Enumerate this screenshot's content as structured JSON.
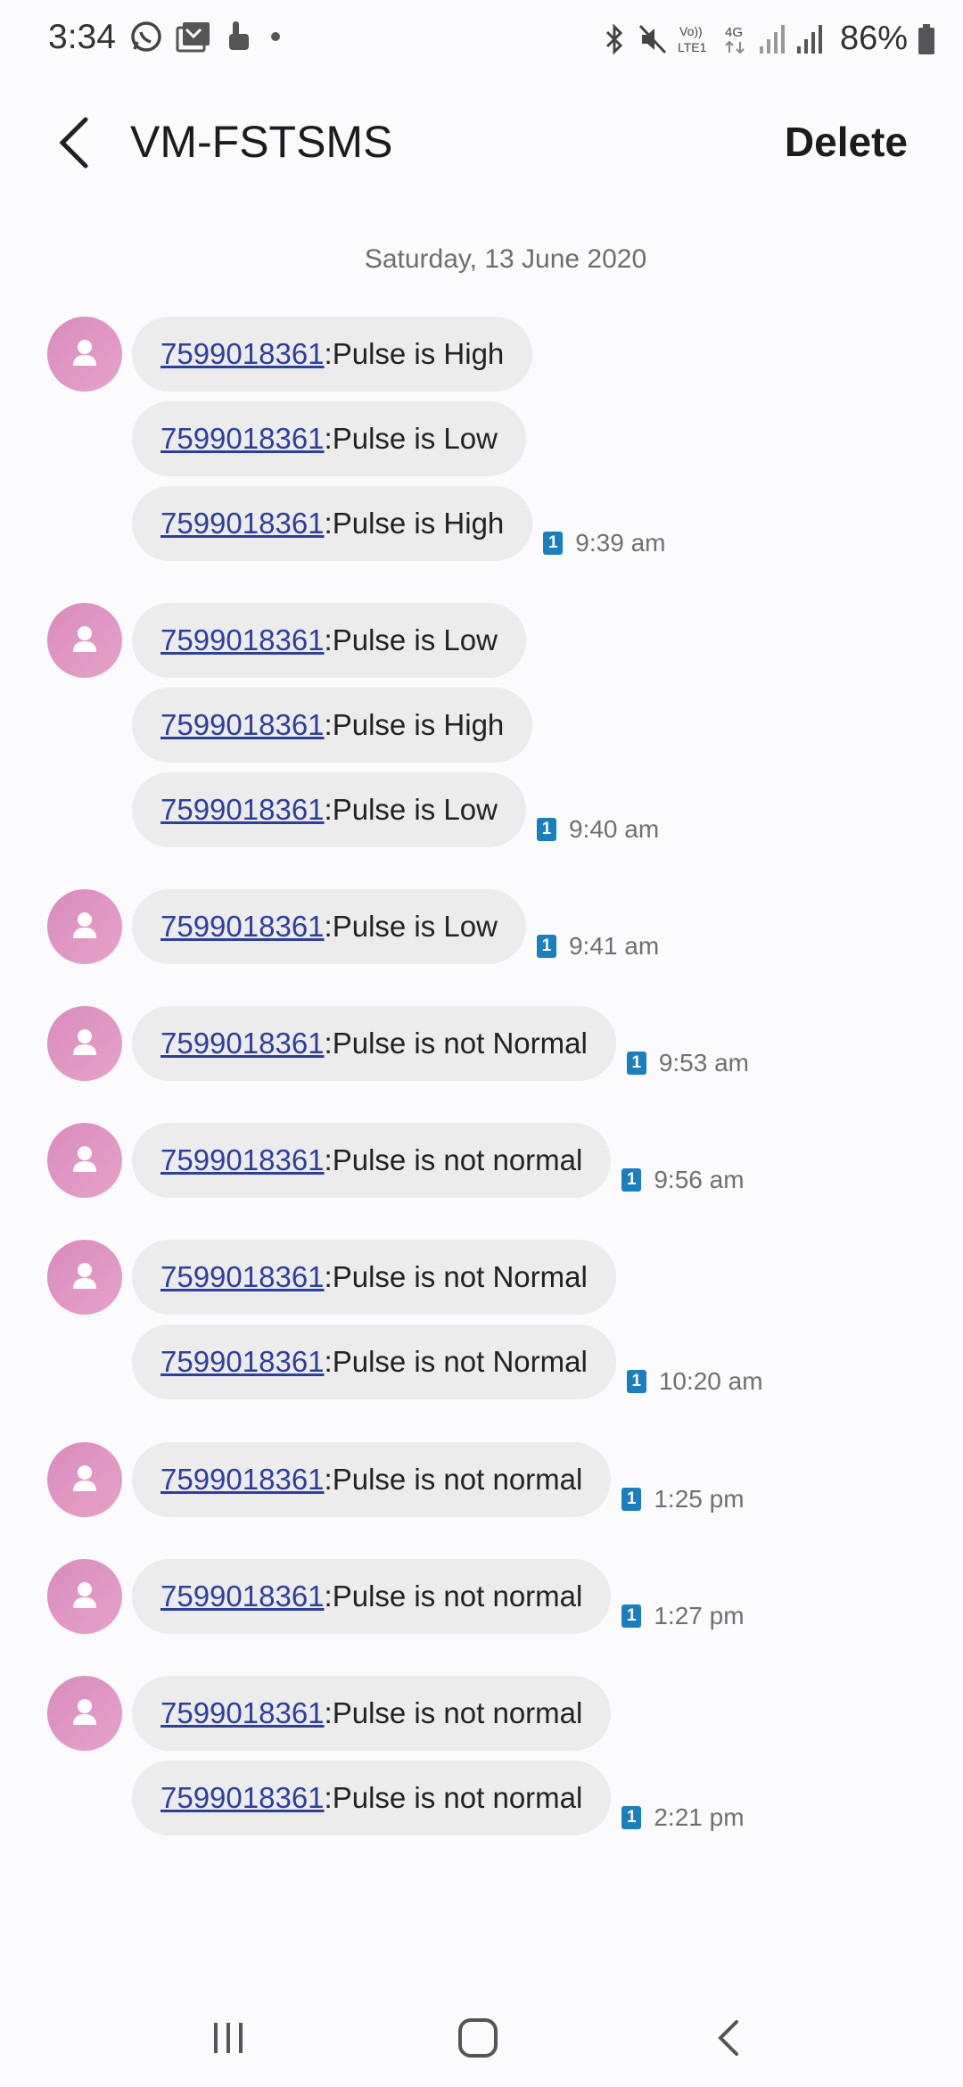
{
  "status_bar": {
    "time": "3:34",
    "battery": "86%",
    "icons_left": [
      "whatsapp-icon",
      "gallery-icon",
      "touch-icon",
      "dot-icon"
    ],
    "icons_right": [
      "bluetooth-icon",
      "mute-icon",
      "volte-icon",
      "4g-icon",
      "signal-icon",
      "signal-icon",
      "battery-icon"
    ],
    "network_labels": {
      "volte": "Vo)) LTE1",
      "data": "4G"
    }
  },
  "header": {
    "title": "VM-FSTSMS",
    "delete_label": "Delete"
  },
  "date_separator": "Saturday, 13 June 2020",
  "message_groups": [
    {
      "messages": [
        {
          "number": "7599018361",
          "text": ":Pulse is High"
        },
        {
          "number": "7599018361",
          "text": ":Pulse is Low"
        },
        {
          "number": "7599018361",
          "text": ":Pulse is High"
        }
      ],
      "sim": "1",
      "time": "9:39 am"
    },
    {
      "messages": [
        {
          "number": "7599018361",
          "text": ":Pulse is Low"
        },
        {
          "number": "7599018361",
          "text": ":Pulse is High"
        },
        {
          "number": "7599018361",
          "text": ":Pulse is Low"
        }
      ],
      "sim": "1",
      "time": "9:40 am"
    },
    {
      "messages": [
        {
          "number": "7599018361",
          "text": ":Pulse is Low"
        }
      ],
      "sim": "1",
      "time": "9:41 am"
    },
    {
      "messages": [
        {
          "number": "7599018361",
          "text": ":Pulse is not Normal"
        }
      ],
      "sim": "1",
      "time": "9:53 am"
    },
    {
      "messages": [
        {
          "number": "7599018361",
          "text": ":Pulse is not normal"
        }
      ],
      "sim": "1",
      "time": "9:56 am"
    },
    {
      "messages": [
        {
          "number": "7599018361",
          "text": ":Pulse is not Normal"
        },
        {
          "number": "7599018361",
          "text": ":Pulse is not Normal"
        }
      ],
      "sim": "1",
      "time": "10:20 am"
    },
    {
      "messages": [
        {
          "number": "7599018361",
          "text": ":Pulse is not normal"
        }
      ],
      "sim": "1",
      "time": "1:25 pm"
    },
    {
      "messages": [
        {
          "number": "7599018361",
          "text": ":Pulse is not normal"
        }
      ],
      "sim": "1",
      "time": "1:27 pm"
    },
    {
      "messages": [
        {
          "number": "7599018361",
          "text": ":Pulse is not normal"
        },
        {
          "number": "7599018361",
          "text": ":Pulse is not normal"
        }
      ],
      "sim": "1",
      "time": "2:21 pm"
    }
  ],
  "nav_bar": {
    "buttons": [
      "recents-icon",
      "home-icon",
      "back-icon"
    ]
  },
  "colors": {
    "avatar": "#e0a0c8",
    "bubble": "#ececec",
    "link": "#2c3fa0",
    "sim_badge": "#1a7fc1"
  }
}
